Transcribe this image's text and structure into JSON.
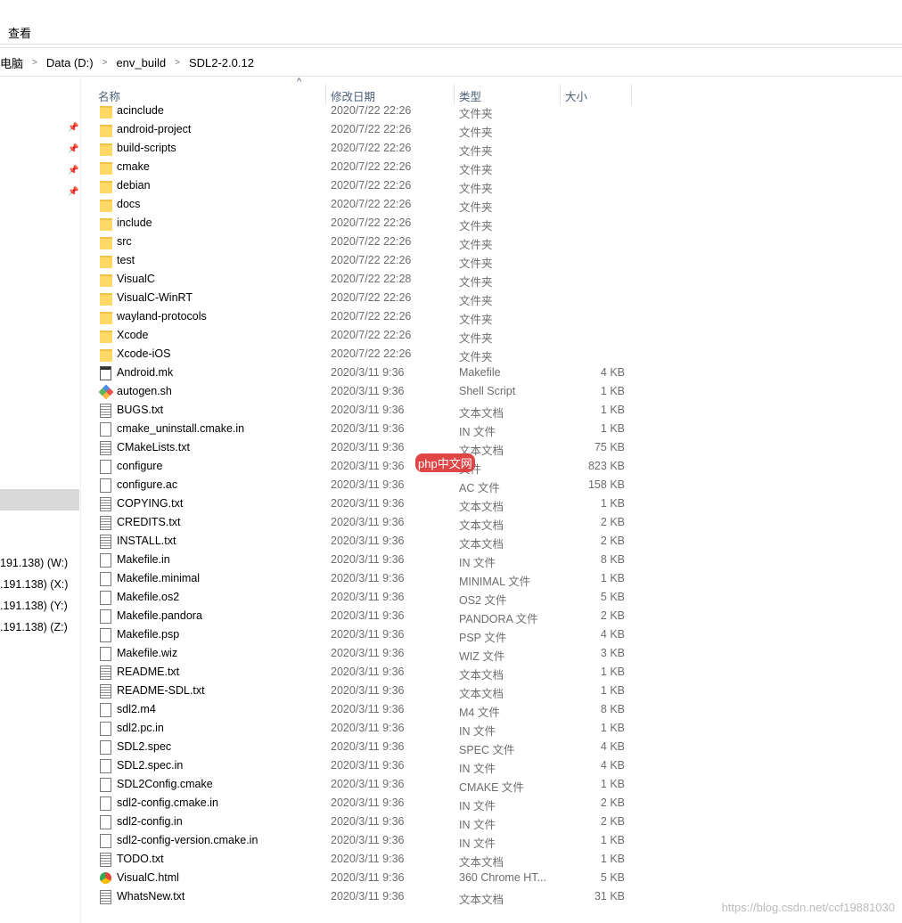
{
  "menu": {
    "view": "查看"
  },
  "breadcrumb": [
    "电脑",
    "Data (D:)",
    "env_build",
    "SDL2-2.0.12"
  ],
  "sidebar": {
    "drives": [
      "191.138) (W:)",
      ".191.138) (X:)",
      ".191.138) (Y:)",
      ".191.138) (Z:)"
    ]
  },
  "columns": {
    "name": "名称",
    "date": "修改日期",
    "type": "类型",
    "size": "大小"
  },
  "files": [
    [
      "folder",
      "acinclude",
      "2020/7/22 22:26",
      "文件夹",
      ""
    ],
    [
      "folder",
      "android-project",
      "2020/7/22 22:26",
      "文件夹",
      ""
    ],
    [
      "folder",
      "build-scripts",
      "2020/7/22 22:26",
      "文件夹",
      ""
    ],
    [
      "folder",
      "cmake",
      "2020/7/22 22:26",
      "文件夹",
      ""
    ],
    [
      "folder",
      "debian",
      "2020/7/22 22:26",
      "文件夹",
      ""
    ],
    [
      "folder",
      "docs",
      "2020/7/22 22:26",
      "文件夹",
      ""
    ],
    [
      "folder",
      "include",
      "2020/7/22 22:26",
      "文件夹",
      ""
    ],
    [
      "folder",
      "src",
      "2020/7/22 22:26",
      "文件夹",
      ""
    ],
    [
      "folder",
      "test",
      "2020/7/22 22:26",
      "文件夹",
      ""
    ],
    [
      "folder",
      "VisualC",
      "2020/7/22 22:28",
      "文件夹",
      ""
    ],
    [
      "folder",
      "VisualC-WinRT",
      "2020/7/22 22:26",
      "文件夹",
      ""
    ],
    [
      "folder",
      "wayland-protocols",
      "2020/7/22 22:26",
      "文件夹",
      ""
    ],
    [
      "folder",
      "Xcode",
      "2020/7/22 22:26",
      "文件夹",
      ""
    ],
    [
      "folder",
      "Xcode-iOS",
      "2020/7/22 22:26",
      "文件夹",
      ""
    ],
    [
      "mk",
      "Android.mk",
      "2020/3/11 9:36",
      "Makefile",
      "4 KB"
    ],
    [
      "git",
      "autogen.sh",
      "2020/3/11 9:36",
      "Shell Script",
      "1 KB"
    ],
    [
      "txt",
      "BUGS.txt",
      "2020/3/11 9:36",
      "文本文档",
      "1 KB"
    ],
    [
      "file",
      "cmake_uninstall.cmake.in",
      "2020/3/11 9:36",
      "IN 文件",
      "1 KB"
    ],
    [
      "txt",
      "CMakeLists.txt",
      "2020/3/11 9:36",
      "文本文档",
      "75 KB"
    ],
    [
      "file",
      "configure",
      "2020/3/11 9:36",
      "文件",
      "823 KB"
    ],
    [
      "file",
      "configure.ac",
      "2020/3/11 9:36",
      "AC 文件",
      "158 KB"
    ],
    [
      "txt",
      "COPYING.txt",
      "2020/3/11 9:36",
      "文本文档",
      "1 KB"
    ],
    [
      "txt",
      "CREDITS.txt",
      "2020/3/11 9:36",
      "文本文档",
      "2 KB"
    ],
    [
      "txt",
      "INSTALL.txt",
      "2020/3/11 9:36",
      "文本文档",
      "2 KB"
    ],
    [
      "file",
      "Makefile.in",
      "2020/3/11 9:36",
      "IN 文件",
      "8 KB"
    ],
    [
      "file",
      "Makefile.minimal",
      "2020/3/11 9:36",
      "MINIMAL 文件",
      "1 KB"
    ],
    [
      "file",
      "Makefile.os2",
      "2020/3/11 9:36",
      "OS2 文件",
      "5 KB"
    ],
    [
      "file",
      "Makefile.pandora",
      "2020/3/11 9:36",
      "PANDORA 文件",
      "2 KB"
    ],
    [
      "file",
      "Makefile.psp",
      "2020/3/11 9:36",
      "PSP 文件",
      "4 KB"
    ],
    [
      "file",
      "Makefile.wiz",
      "2020/3/11 9:36",
      "WIZ 文件",
      "3 KB"
    ],
    [
      "txt",
      "README.txt",
      "2020/3/11 9:36",
      "文本文档",
      "1 KB"
    ],
    [
      "txt",
      "README-SDL.txt",
      "2020/3/11 9:36",
      "文本文档",
      "1 KB"
    ],
    [
      "file",
      "sdl2.m4",
      "2020/3/11 9:36",
      "M4 文件",
      "8 KB"
    ],
    [
      "file",
      "sdl2.pc.in",
      "2020/3/11 9:36",
      "IN 文件",
      "1 KB"
    ],
    [
      "file",
      "SDL2.spec",
      "2020/3/11 9:36",
      "SPEC 文件",
      "4 KB"
    ],
    [
      "file",
      "SDL2.spec.in",
      "2020/3/11 9:36",
      "IN 文件",
      "4 KB"
    ],
    [
      "file",
      "SDL2Config.cmake",
      "2020/3/11 9:36",
      "CMAKE 文件",
      "1 KB"
    ],
    [
      "file",
      "sdl2-config.cmake.in",
      "2020/3/11 9:36",
      "IN 文件",
      "2 KB"
    ],
    [
      "file",
      "sdl2-config.in",
      "2020/3/11 9:36",
      "IN 文件",
      "2 KB"
    ],
    [
      "file",
      "sdl2-config-version.cmake.in",
      "2020/3/11 9:36",
      "IN 文件",
      "1 KB"
    ],
    [
      "txt",
      "TODO.txt",
      "2020/3/11 9:36",
      "文本文档",
      "1 KB"
    ],
    [
      "chrome",
      "VisualC.html",
      "2020/3/11 9:36",
      "360 Chrome HT...",
      "5 KB"
    ],
    [
      "txt",
      "WhatsNew.txt",
      "2020/3/11 9:36",
      "文本文档",
      "31 KB"
    ]
  ],
  "watermarks": {
    "php": "php中文网",
    "csdn": "https://blog.csdn.net/ccf19881030"
  }
}
